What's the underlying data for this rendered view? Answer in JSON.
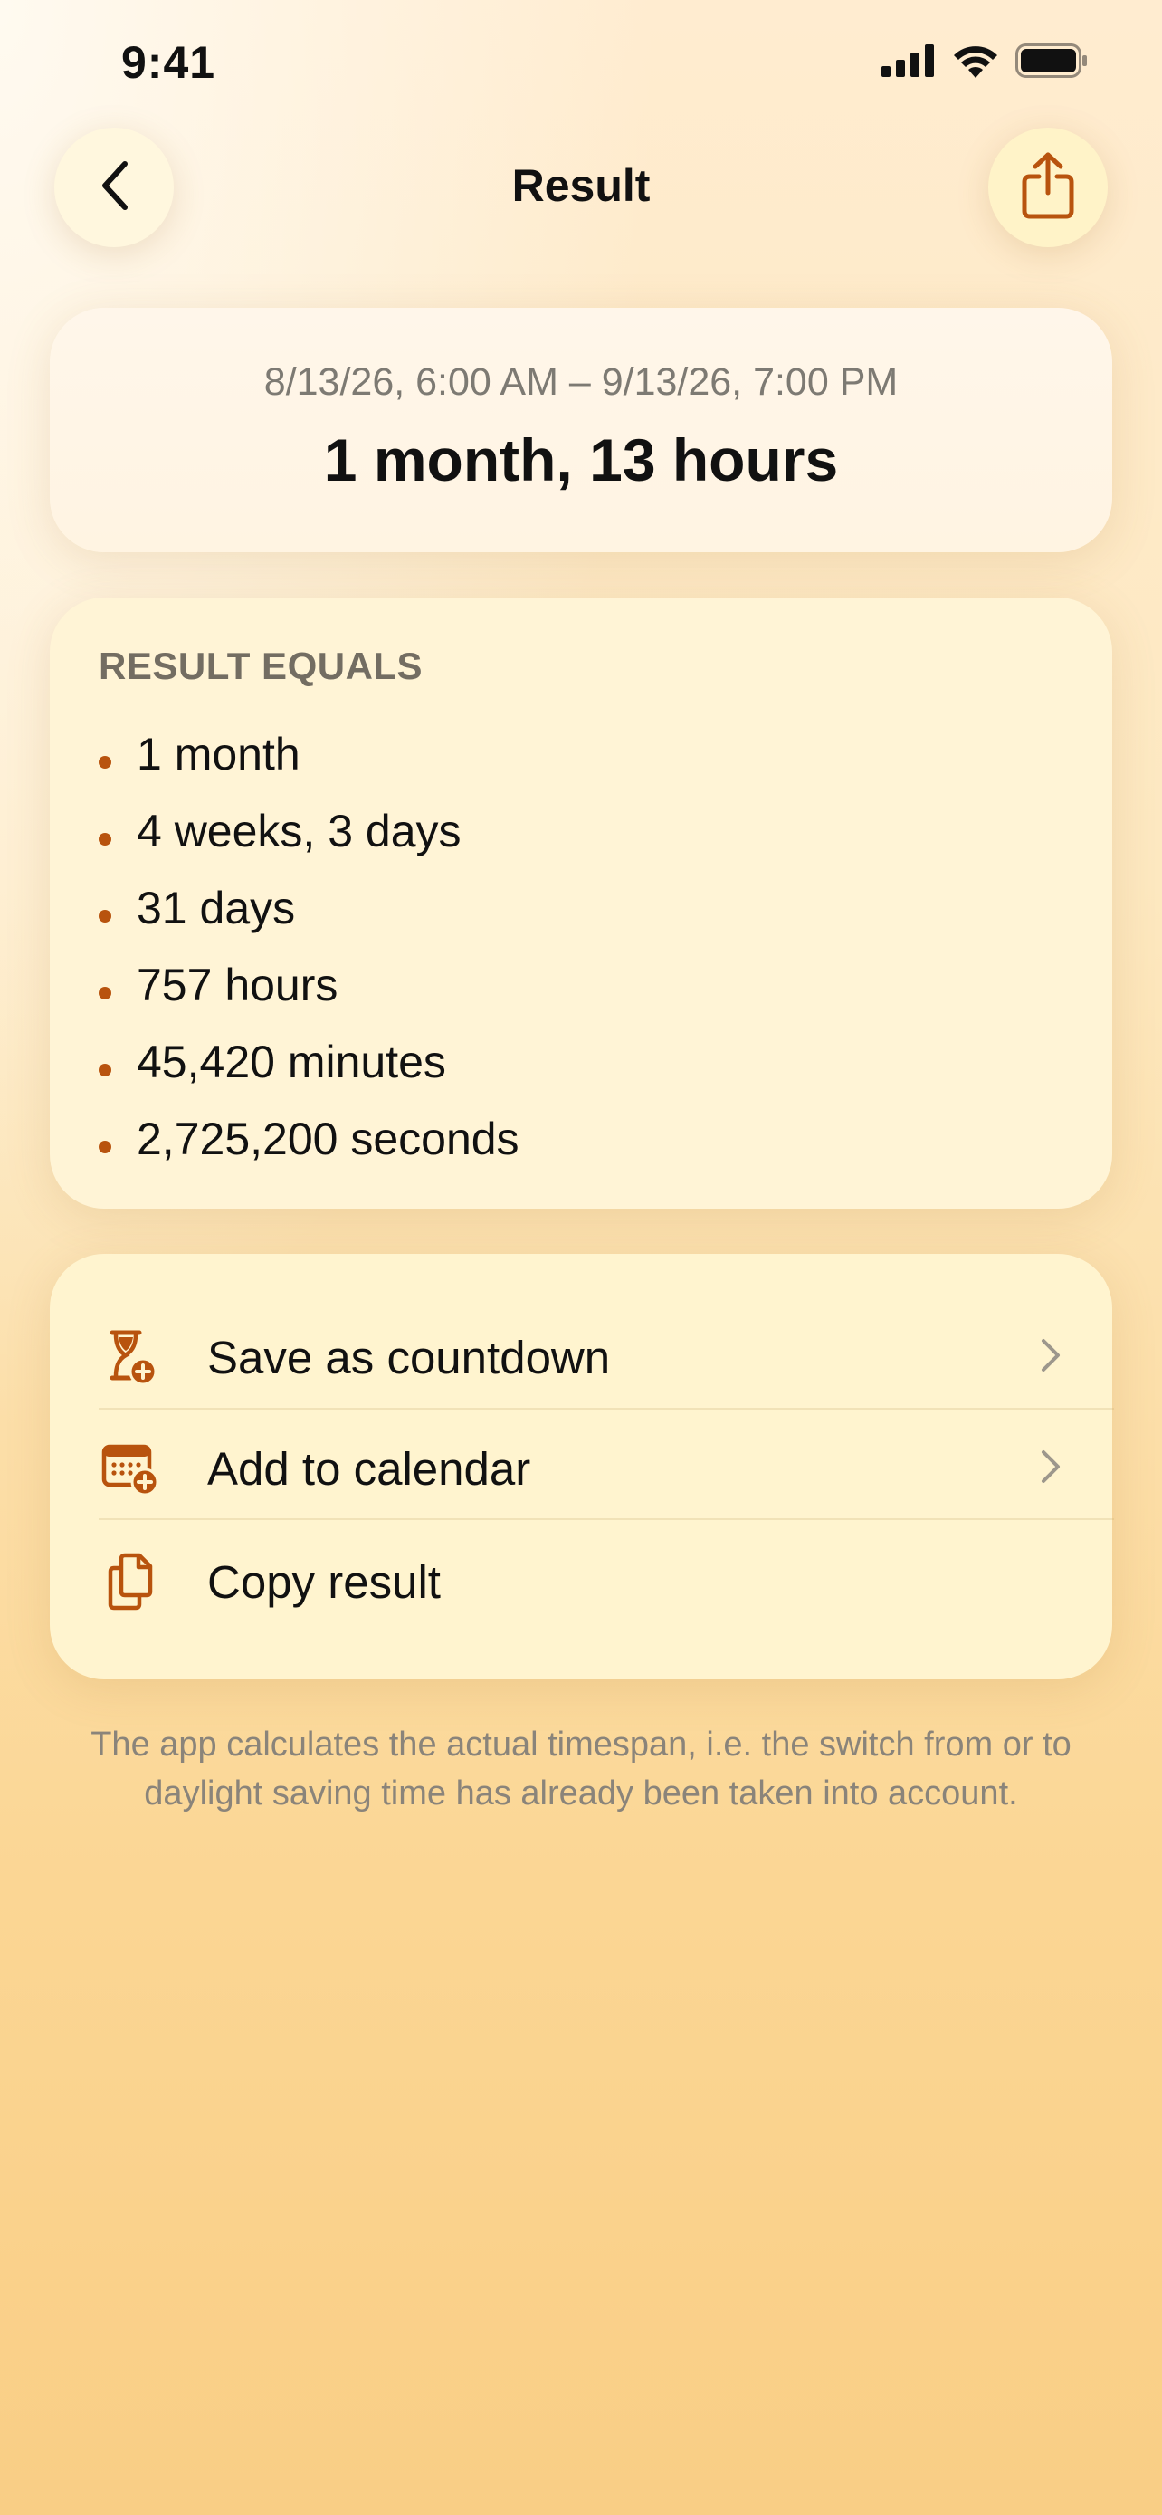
{
  "status_bar": {
    "time": "9:41"
  },
  "nav": {
    "title": "Result"
  },
  "summary": {
    "range": "8/13/26, 6:00 AM – 9/13/26, 7:00 PM",
    "value": "1 month, 13 hours"
  },
  "equals": {
    "heading": "RESULT EQUALS",
    "items": [
      "1 month",
      "4 weeks, 3 days",
      "31 days",
      "757 hours",
      "45,420 minutes",
      "2,725,200 seconds"
    ]
  },
  "actions": [
    {
      "label": "Save as countdown",
      "icon": "hourglass-plus-icon"
    },
    {
      "label": "Add to calendar",
      "icon": "calendar-plus-icon"
    },
    {
      "label": "Copy result",
      "icon": "copy-documents-icon"
    }
  ],
  "footer": {
    "note": "The app calculates the actual timespan, i.e. the switch from or to daylight saving time has already been taken into account."
  },
  "colors": {
    "accent": "#B8530E",
    "background_top": "#FFECD0",
    "background_bottom": "#F9CE85"
  }
}
